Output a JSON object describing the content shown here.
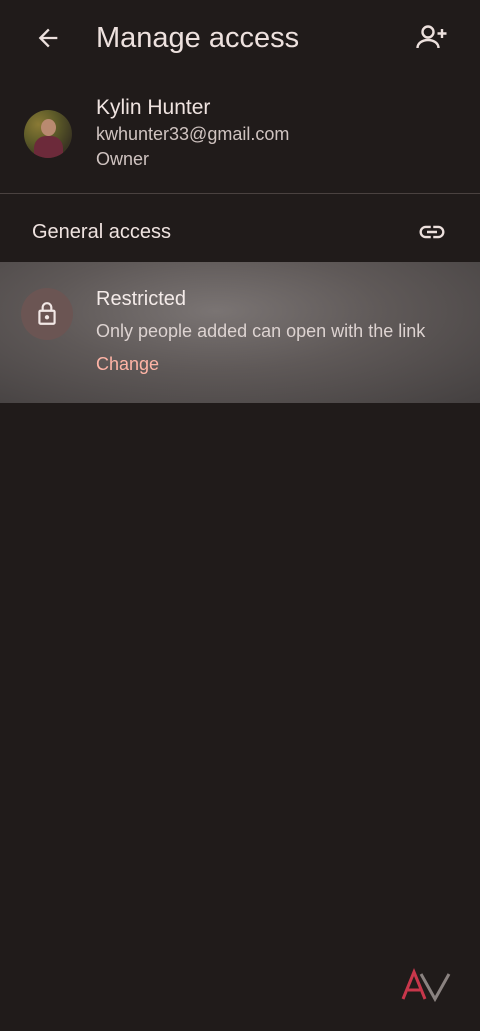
{
  "header": {
    "title": "Manage access",
    "back_icon": "arrow-back-icon",
    "add_icon": "person-add-icon"
  },
  "owner": {
    "name": "Kylin Hunter",
    "email": "kwhunter33@gmail.com",
    "role": "Owner"
  },
  "general_access": {
    "title": "General access",
    "link_icon": "link-icon",
    "setting": {
      "icon": "lock-icon",
      "title": "Restricted",
      "description": "Only people added can open with the link",
      "action_label": "Change"
    }
  },
  "colors": {
    "background": "#201b1a",
    "accent": "#ffb4a6",
    "watermark_red": "#c8374b"
  }
}
